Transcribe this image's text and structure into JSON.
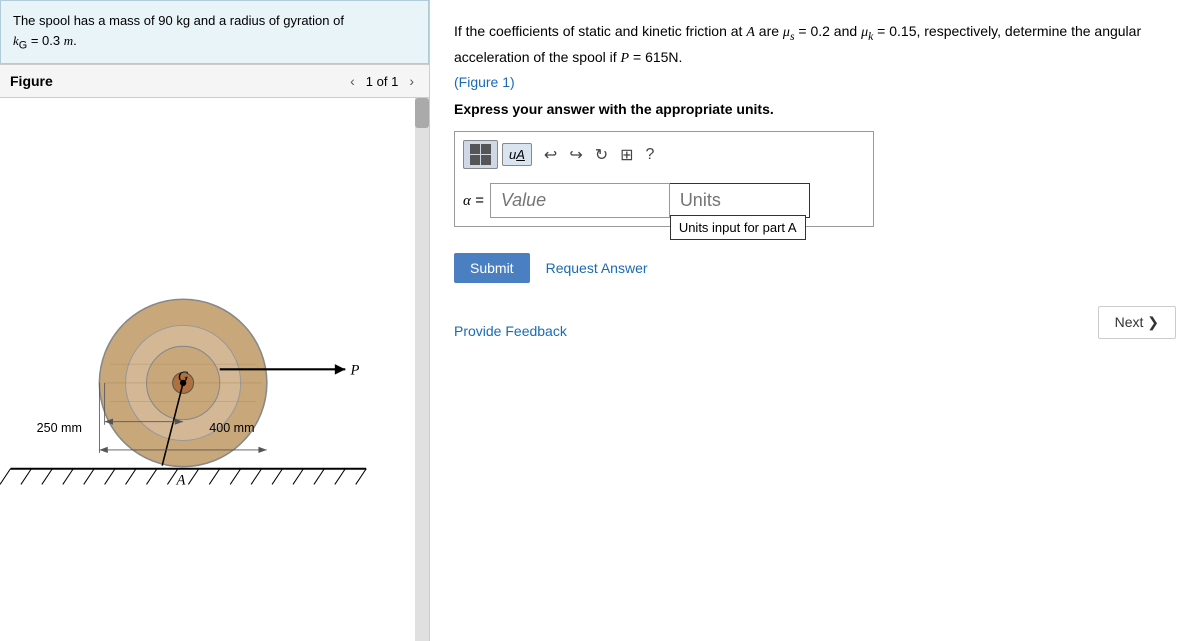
{
  "left_panel": {
    "problem_info": {
      "line1": "The spool has a mass of 90 kg and a radius of gyration of",
      "line2_prefix": "k",
      "line2_subscript": "G",
      "line2_suffix": " = 0.3 m."
    },
    "figure": {
      "title": "Figure",
      "page": "1 of 1"
    }
  },
  "right_panel": {
    "question": {
      "text": "If the coefficients of static and kinetic friction at A are μ s = 0.2 and μ k = 0.15, respectively, determine the angular acceleration of the spool if P = 615N.",
      "figure_link": "(Figure 1)",
      "express_text": "Express your answer with the appropriate units."
    },
    "toolbar": {
      "grid_icon_label": "grid-icon",
      "uA_label": "uA",
      "undo_label": "↩",
      "redo_label": "↪",
      "refresh_label": "↻",
      "keyboard_label": "⌨",
      "help_label": "?"
    },
    "answer": {
      "alpha_label": "α =",
      "value_placeholder": "Value",
      "units_placeholder": "Units",
      "units_tooltip": "Units input for part A"
    },
    "buttons": {
      "submit": "Submit",
      "request_answer": "Request Answer",
      "provide_feedback": "Provide Feedback",
      "next": "Next ❯"
    }
  }
}
